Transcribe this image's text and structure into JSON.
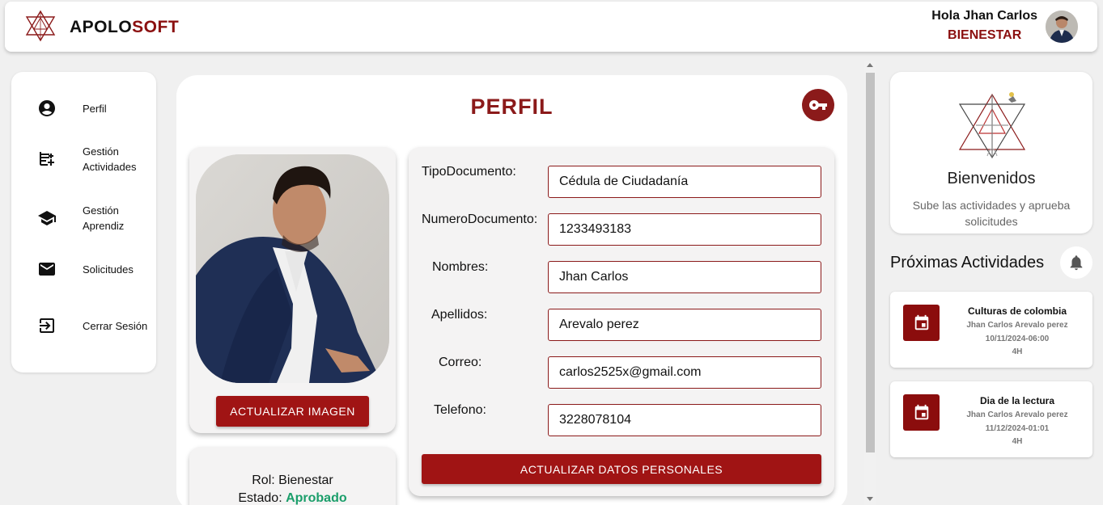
{
  "header": {
    "brand_part1": "APOLO",
    "brand_part2": "SOFT",
    "greeting": "Hola Jhan Carlos",
    "role": "BIENESTAR"
  },
  "sidebar": {
    "items": [
      {
        "label": "Perfil",
        "icon": "account-circle-icon"
      },
      {
        "label": "Gestión Actividades",
        "icon": "note-add-icon"
      },
      {
        "label": "Gestión Aprendiz",
        "icon": "school-icon"
      },
      {
        "label": "Solicitudes",
        "icon": "mail-icon"
      },
      {
        "label": "Cerrar Sesión",
        "icon": "logout-icon"
      }
    ]
  },
  "main": {
    "title": "PERFIL",
    "update_image_label": "ACTUALIZAR IMAGEN",
    "rol_text": "Rol: Bienestar",
    "estado_label": "Estado: ",
    "estado_value": "Aprobado",
    "form": {
      "fields": [
        {
          "label": "TipoDocumento:",
          "value": "Cédula de Ciudadanía"
        },
        {
          "label": "NumeroDocumento:",
          "value": "1233493183"
        },
        {
          "label": "Nombres:",
          "value": "Jhan Carlos"
        },
        {
          "label": "Apellidos:",
          "value": "Arevalo perez"
        },
        {
          "label": "Correo:",
          "value": "carlos2525x@gmail.com"
        },
        {
          "label": "Telefono:",
          "value": "3228078104"
        }
      ],
      "submit_label": "ACTUALIZAR DATOS PERSONALES"
    }
  },
  "right": {
    "welcome_title": "Bienvenidos",
    "welcome_subtitle": "Sube las actividades y aprueba solicitudes",
    "next_title": "Próximas Actividades",
    "activities": [
      {
        "name": "Culturas de colombia",
        "owner": "Jhan Carlos Arevalo perez",
        "date": "10/11/2024-06:00",
        "duration": "4H"
      },
      {
        "name": "Dia de la lectura",
        "owner": "Jhan Carlos Arevalo perez",
        "date": "11/12/2024-01:01",
        "duration": "4H"
      }
    ]
  },
  "colors": {
    "brand_red": "#8b1010",
    "button_red": "#a01414",
    "approved_green": "#1a9e6a"
  }
}
